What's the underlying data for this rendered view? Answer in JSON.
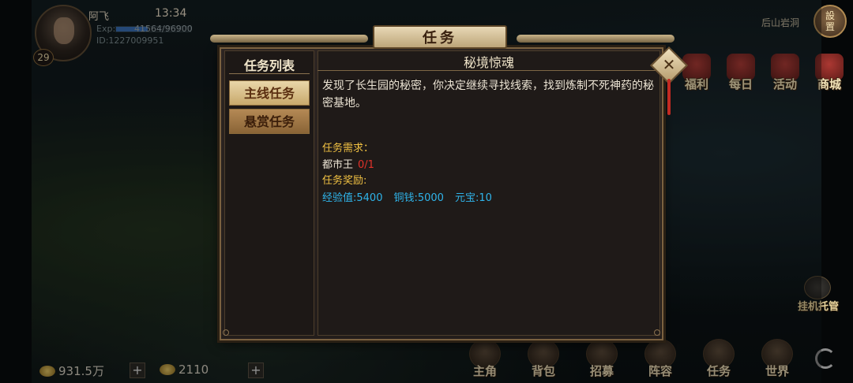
{
  "player": {
    "name": "阿飞",
    "time": "13:34",
    "exp_label": "Exp:",
    "exp_value": "41564/96900",
    "exp_fraction": 0.429,
    "id": "ID:1227009951",
    "level": "29"
  },
  "location": "后山岩洞",
  "settings": {
    "line1": "設",
    "line2": "置"
  },
  "side_menu": [
    {
      "label": "福利",
      "icon": "gift-icon"
    },
    {
      "label": "每日",
      "icon": "calendar-icon"
    },
    {
      "label": "活动",
      "icon": "lantern-icon"
    },
    {
      "label": "商城",
      "icon": "shop-icon"
    }
  ],
  "auto_battle": {
    "label": "挂机托管"
  },
  "currency": {
    "silver": "931.5万",
    "gold": "2110"
  },
  "bottom_menu": [
    {
      "label": "主角",
      "icon": "hero-icon"
    },
    {
      "label": "背包",
      "icon": "bag-icon"
    },
    {
      "label": "招募",
      "icon": "recruit-icon"
    },
    {
      "label": "阵容",
      "icon": "formation-icon"
    },
    {
      "label": "任务",
      "icon": "task-icon"
    },
    {
      "label": "世界",
      "icon": "world-icon"
    }
  ],
  "task_window": {
    "title": "任务",
    "list_header": "任务列表",
    "tabs": [
      {
        "label": "主线任务",
        "active": true
      },
      {
        "label": "悬赏任务",
        "active": false
      }
    ],
    "detail": {
      "name": "秘境惊魂",
      "description": "发现了长生园的秘密，你决定继续寻找线索，找到炼制不死神药的秘密基地。",
      "requirement_header": "任务需求：",
      "requirement_target": "都市王",
      "requirement_progress": "0/1",
      "reward_header": "任务奖励:",
      "rewards": [
        "经验值:5400",
        "铜钱:5000",
        "元宝:10"
      ]
    }
  }
}
